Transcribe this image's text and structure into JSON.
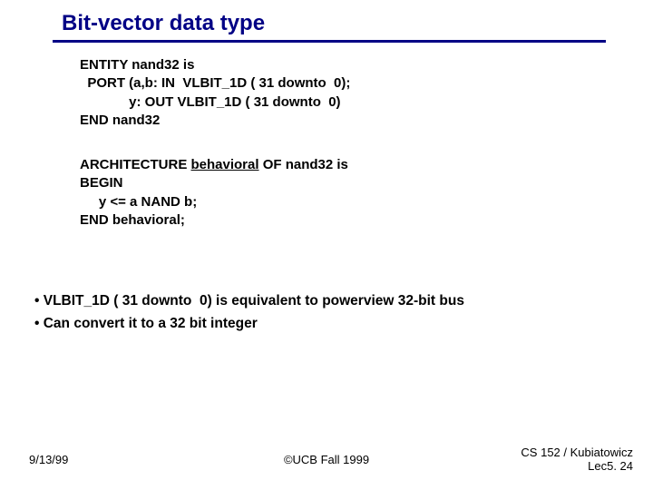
{
  "title": "Bit-vector data type",
  "code1": {
    "l1": "ENTITY nand32 is",
    "l2": "  PORT (a,b: IN  VLBIT_1D ( 31 downto  0);",
    "l3": "             y: OUT VLBIT_1D ( 31 downto  0)",
    "l4": "END nand32"
  },
  "code2": {
    "arch_pre": "ARCHITECTURE ",
    "arch_ul": "behavioral",
    "arch_post": " OF nand32 is",
    "begin": "BEGIN",
    "body": "     y <= a NAND b;",
    "end": "END behavioral;"
  },
  "bullets": {
    "b1": "• VLBIT_1D ( 31 downto  0) is equivalent to powerview 32-bit bus",
    "b2": "• Can convert it to a 32 bit integer"
  },
  "footer": {
    "left": "9/13/99",
    "center": "©UCB Fall 1999",
    "right1": "CS 152 / Kubiatowicz",
    "right2": "Lec5. 24"
  }
}
